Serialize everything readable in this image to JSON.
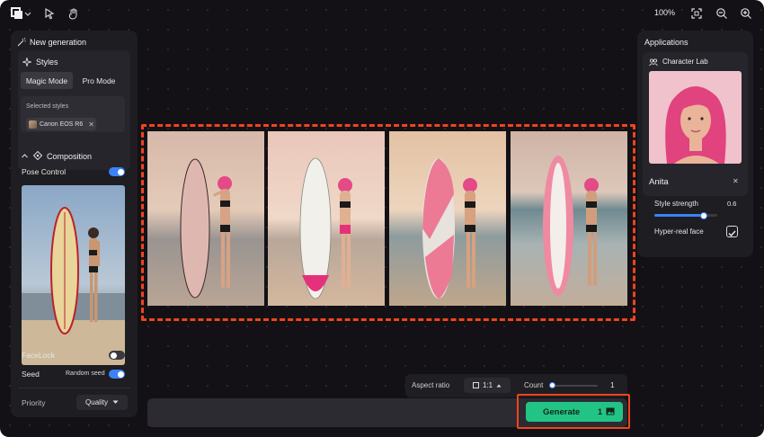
{
  "topbar": {
    "logo_icon": "layers-logo-icon",
    "tools": [
      "pointer-icon",
      "hand-icon"
    ],
    "zoom_label": "100%",
    "right_icons": [
      "fit-screen-icon",
      "zoom-out-icon",
      "zoom-in-icon"
    ]
  },
  "left_panel": {
    "title": "New generation",
    "styles": {
      "title": "Styles",
      "tabs": [
        {
          "label": "Magic Mode",
          "active": true
        },
        {
          "label": "Pro Mode",
          "active": false
        }
      ],
      "selected_label": "Selected styles",
      "chip_label": "Canon EOS R6"
    },
    "composition": {
      "title": "Composition",
      "pose_control_label": "Pose Control",
      "pose_control_on": true,
      "facelock_label": "FaceLock",
      "facelock_on": false,
      "seed_label": "Seed",
      "random_seed_label": "Random seed",
      "random_seed_on": true
    },
    "priority": {
      "label": "Priority",
      "value": "Quality"
    }
  },
  "right_panel": {
    "title": "Applications",
    "character_lab_label": "Character Lab",
    "character_name": "Anita",
    "style_strength_label": "Style strength",
    "style_strength_value": "0.6",
    "style_strength_fraction": 0.78,
    "hyper_real_label": "Hyper-real face",
    "hyper_real_checked": true
  },
  "bottom": {
    "aspect_ratio_label": "Aspect ratio",
    "aspect_ratio_value": "1:1",
    "count_label": "Count",
    "count_value": "1",
    "generate_label": "Generate",
    "generate_count": "1"
  },
  "colors": {
    "accent_green": "#22c486",
    "highlight_orange": "#f0441e",
    "toggle_blue": "#3b82f6",
    "panel_bg": "#1e1d22"
  }
}
